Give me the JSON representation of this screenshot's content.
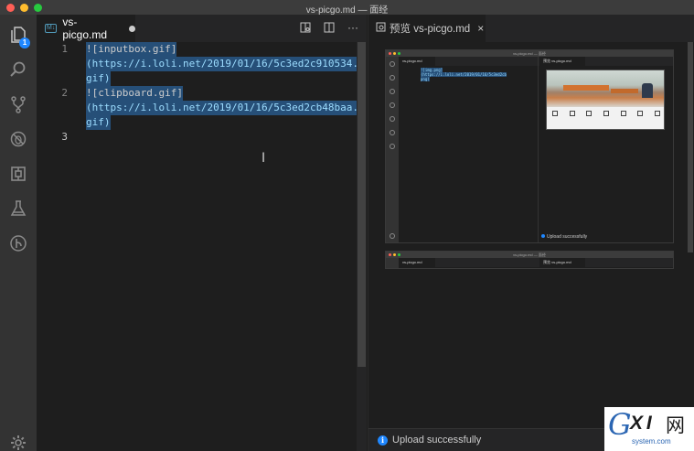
{
  "window": {
    "title": "vs-picgo.md — 面经"
  },
  "activity_bar": {
    "items": [
      {
        "name": "explorer-icon",
        "badge": "1"
      },
      {
        "name": "search-icon"
      },
      {
        "name": "source-control-icon"
      },
      {
        "name": "debug-icon"
      },
      {
        "name": "extensions-icon"
      },
      {
        "name": "test-flask-icon"
      },
      {
        "name": "gitlens-icon"
      }
    ],
    "settings_icon": "gear-icon"
  },
  "editor": {
    "tab": {
      "label": "vs-picgo.md",
      "icon_text": "M↓",
      "dirty": true
    },
    "actions": [
      "open-preview-to-side-icon",
      "split-editor-icon",
      "more-actions-icon"
    ],
    "lines": [
      {
        "number": "1",
        "wrapped": [
          "![inputbox.gif]",
          "(https://i.loli.net/2019/01/16/5c3ed2c910534.",
          "gif)"
        ]
      },
      {
        "number": "2",
        "wrapped": [
          "![clipboard.gif]",
          "(https://i.loli.net/2019/01/16/5c3ed2cb48baa.",
          "gif)"
        ]
      },
      {
        "number": "3",
        "wrapped": [
          ""
        ]
      }
    ]
  },
  "preview": {
    "tab": {
      "label": "预览 vs-picgo.md",
      "close": "×"
    },
    "frame_title": "vs-picgo.md — 面经",
    "frame_tab": "vs-picgo.md",
    "frame_preview_tab": "预览 vs-picgo.md",
    "frame_code": [
      "![img.png]",
      "(https://i.loli.net/2019/01/16/5c3ed2cb",
      "png)"
    ],
    "frame_status": "Upload successfully"
  },
  "notification": {
    "text": "Upload successfully",
    "icon": "info-icon"
  },
  "watermark": {
    "brand_g": "G",
    "brand_xi": "X I",
    "brand_wang": "网",
    "domain": "system.com"
  },
  "colors": {
    "accent": "#1f87ff",
    "selection": "#264f78",
    "background": "#1e1e1e"
  }
}
